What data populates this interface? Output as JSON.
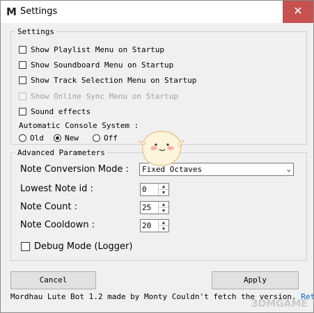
{
  "window": {
    "logo_letter": "M",
    "title": "Settings",
    "close_glyph": "✕"
  },
  "settings": {
    "legend": "Settings",
    "show_playlist": {
      "label": "Show Playlist Menu on Startup",
      "checked": false
    },
    "show_soundboard": {
      "label": "Show Soundboard Menu on Startup",
      "checked": false
    },
    "show_track_selection": {
      "label": "Show Track Selection Menu on Startup",
      "checked": false
    },
    "show_online_sync": {
      "label": "Show Online Sync Menu on Startup",
      "checked": false,
      "disabled": true
    },
    "sound_effects": {
      "label": "Sound effects",
      "checked": false
    },
    "console_label": "Automatic Console System :",
    "console_options": [
      "Old",
      "New",
      "Off"
    ],
    "console_selected": "New"
  },
  "advanced": {
    "legend": "Advanced Parameters",
    "note_conversion_label": "Note Conversion Mode :",
    "note_conversion_value": "Fixed Octaves",
    "lowest_note_label": "Lowest Note id :",
    "lowest_note_value": "0",
    "note_count_label": "Note Count :",
    "note_count_value": "25",
    "note_cooldown_label": "Note Cooldown :",
    "note_cooldown_value": "20",
    "debug_label": "Debug Mode (Logger)",
    "debug_checked": false
  },
  "buttons": {
    "cancel": "Cancel",
    "apply": "Apply"
  },
  "status": {
    "text": "Mordhau Lute Bot 1.2 made by Monty  Couldn't fetch the version.",
    "link": "Retry"
  },
  "overlay": {
    "watermark": "3DMGAME"
  },
  "icons": {
    "spin_up": "▲",
    "spin_down": "▼",
    "dropdown": "chevron-down-icon"
  },
  "colors": {
    "close_button": "#c7514f",
    "link": "#0b62c4"
  }
}
